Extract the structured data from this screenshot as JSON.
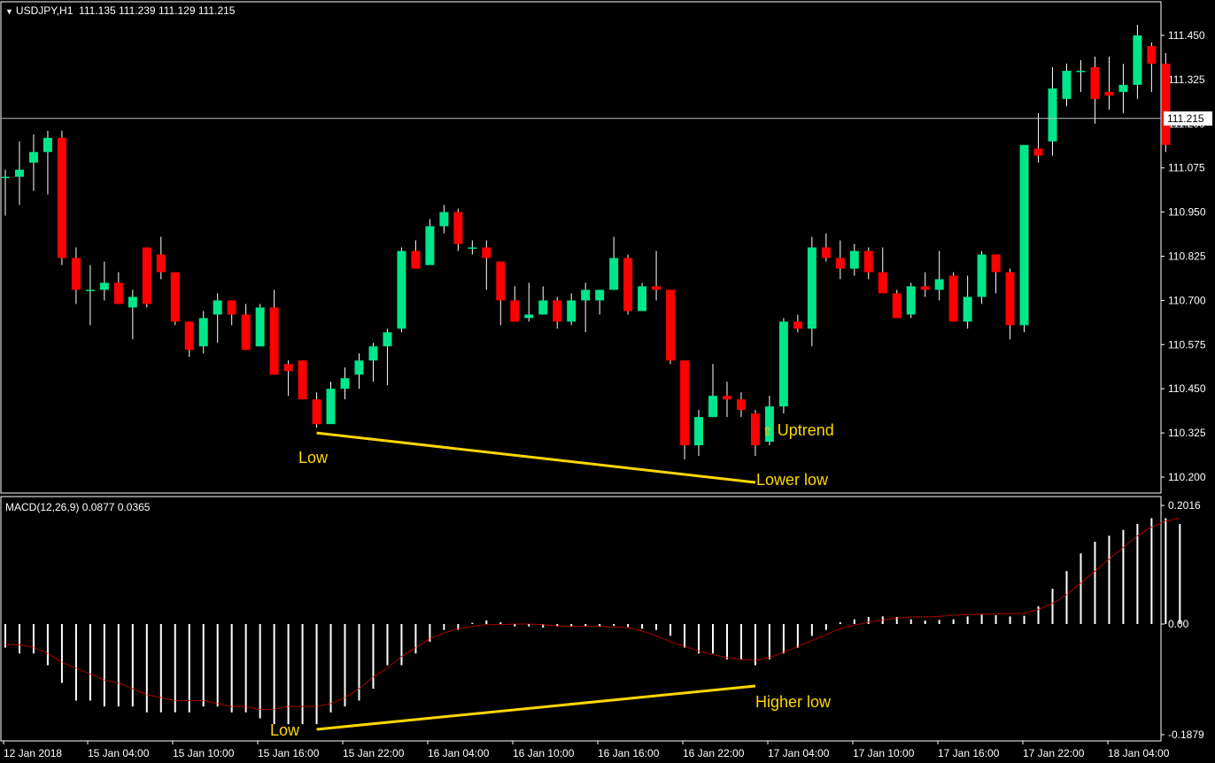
{
  "header": {
    "symbol_label": "USDJPY,H1",
    "ohlc_values": "111.135 111.239 111.129 111.215",
    "dropdown_icon": "triangle-down-icon"
  },
  "indicator": {
    "label": "MACD(12,26,9)",
    "values": "0.0877 0.0365"
  },
  "annotations": {
    "price_low": "Low",
    "price_lower_low": "Lower low",
    "uptrend": "Uptrend",
    "uptrend_icon": "arrow-up-outline-icon",
    "macd_low": "Low",
    "macd_higher_low": "Higher low"
  },
  "colors": {
    "background": "#000000",
    "bull": "#00e68a",
    "bear": "#ff0000",
    "wick": "#ffffff",
    "grid_border": "#ffffff",
    "annotation": "#ffd700",
    "signal_line": "#ff0000",
    "macd_bar": "#ffffff"
  },
  "chart_data": [
    {
      "type": "candlestick",
      "symbol": "USDJPY",
      "timeframe": "H1",
      "current_price": 111.215,
      "y_ticks": [
        "111.450",
        "111.325",
        "111.200",
        "111.075",
        "110.950",
        "110.825",
        "110.700",
        "110.575",
        "110.450",
        "110.325",
        "110.200"
      ],
      "ylim": [
        110.16,
        111.53
      ],
      "x_ticks": [
        "12 Jan 2018",
        "15 Jan 04:00",
        "15 Jan 10:00",
        "15 Jan 16:00",
        "15 Jan 22:00",
        "16 Jan 04:00",
        "16 Jan 10:00",
        "16 Jan 16:00",
        "16 Jan 22:00",
        "17 Jan 04:00",
        "17 Jan 10:00",
        "17 Jan 16:00",
        "17 Jan 22:00",
        "18 Jan 04:00"
      ],
      "candles": [
        [
          111.05,
          111.07,
          110.94,
          111.05
        ],
        [
          111.05,
          111.15,
          110.97,
          111.07
        ],
        [
          111.09,
          111.17,
          111.01,
          111.12
        ],
        [
          111.12,
          111.18,
          111.0,
          111.16
        ],
        [
          111.16,
          111.18,
          110.8,
          110.82
        ],
        [
          110.82,
          110.85,
          110.69,
          110.73
        ],
        [
          110.73,
          110.8,
          110.63,
          110.73
        ],
        [
          110.73,
          110.81,
          110.7,
          110.75
        ],
        [
          110.75,
          110.78,
          110.69,
          110.69
        ],
        [
          110.68,
          110.73,
          110.59,
          110.71
        ],
        [
          110.85,
          110.85,
          110.68,
          110.69
        ],
        [
          110.83,
          110.88,
          110.76,
          110.78
        ],
        [
          110.78,
          110.78,
          110.63,
          110.64
        ],
        [
          110.64,
          110.64,
          110.54,
          110.56
        ],
        [
          110.57,
          110.67,
          110.55,
          110.65
        ],
        [
          110.66,
          110.72,
          110.58,
          110.7
        ],
        [
          110.7,
          110.7,
          110.63,
          110.66
        ],
        [
          110.66,
          110.69,
          110.56,
          110.56
        ],
        [
          110.57,
          110.69,
          110.57,
          110.68
        ],
        [
          110.68,
          110.73,
          110.49,
          110.49
        ],
        [
          110.52,
          110.53,
          110.43,
          110.5
        ],
        [
          110.53,
          110.53,
          110.42,
          110.42
        ],
        [
          110.42,
          110.44,
          110.34,
          110.35
        ],
        [
          110.35,
          110.47,
          110.35,
          110.45
        ],
        [
          110.45,
          110.51,
          110.42,
          110.48
        ],
        [
          110.49,
          110.55,
          110.45,
          110.53
        ],
        [
          110.53,
          110.58,
          110.47,
          110.57
        ],
        [
          110.57,
          110.62,
          110.46,
          110.61
        ],
        [
          110.62,
          110.85,
          110.61,
          110.84
        ],
        [
          110.84,
          110.87,
          110.79,
          110.79
        ],
        [
          110.8,
          110.93,
          110.8,
          110.91
        ],
        [
          110.91,
          110.97,
          110.89,
          110.95
        ],
        [
          110.95,
          110.96,
          110.84,
          110.86
        ],
        [
          110.85,
          110.87,
          110.83,
          110.85
        ],
        [
          110.85,
          110.87,
          110.73,
          110.82
        ],
        [
          110.81,
          110.81,
          110.63,
          110.7
        ],
        [
          110.7,
          110.74,
          110.64,
          110.64
        ],
        [
          110.65,
          110.75,
          110.64,
          110.66
        ],
        [
          110.66,
          110.74,
          110.66,
          110.7
        ],
        [
          110.7,
          110.71,
          110.62,
          110.64
        ],
        [
          110.64,
          110.72,
          110.63,
          110.7
        ],
        [
          110.7,
          110.75,
          110.61,
          110.73
        ],
        [
          110.7,
          110.73,
          110.66,
          110.73
        ],
        [
          110.73,
          110.88,
          110.73,
          110.82
        ],
        [
          110.82,
          110.83,
          110.66,
          110.67
        ],
        [
          110.67,
          110.75,
          110.67,
          110.74
        ],
        [
          110.74,
          110.84,
          110.7,
          110.73
        ],
        [
          110.73,
          110.73,
          110.52,
          110.53
        ],
        [
          110.53,
          110.53,
          110.25,
          110.29
        ],
        [
          110.29,
          110.39,
          110.26,
          110.37
        ],
        [
          110.37,
          110.52,
          110.37,
          110.43
        ],
        [
          110.43,
          110.47,
          110.37,
          110.42
        ],
        [
          110.42,
          110.44,
          110.37,
          110.39
        ],
        [
          110.38,
          110.39,
          110.26,
          110.29
        ],
        [
          110.3,
          110.43,
          110.29,
          110.4
        ],
        [
          110.4,
          110.65,
          110.38,
          110.64
        ],
        [
          110.64,
          110.66,
          110.61,
          110.62
        ],
        [
          110.62,
          110.88,
          110.57,
          110.85
        ],
        [
          110.85,
          110.89,
          110.81,
          110.82
        ],
        [
          110.82,
          110.87,
          110.76,
          110.79
        ],
        [
          110.79,
          110.86,
          110.77,
          110.84
        ],
        [
          110.84,
          110.85,
          110.76,
          110.78
        ],
        [
          110.78,
          110.85,
          110.73,
          110.72
        ],
        [
          110.72,
          110.73,
          110.65,
          110.65
        ],
        [
          110.66,
          110.75,
          110.65,
          110.74
        ],
        [
          110.74,
          110.78,
          110.71,
          110.73
        ],
        [
          110.73,
          110.84,
          110.7,
          110.76
        ],
        [
          110.77,
          110.78,
          110.64,
          110.64
        ],
        [
          110.64,
          110.77,
          110.62,
          110.71
        ],
        [
          110.71,
          110.84,
          110.69,
          110.83
        ],
        [
          110.83,
          110.83,
          110.72,
          110.78
        ],
        [
          110.78,
          110.79,
          110.59,
          110.63
        ],
        [
          110.63,
          110.81,
          110.61,
          111.14
        ],
        [
          111.13,
          111.23,
          111.09,
          111.11
        ],
        [
          111.15,
          111.36,
          111.11,
          111.3
        ],
        [
          111.27,
          111.37,
          111.25,
          111.35
        ],
        [
          111.35,
          111.38,
          111.29,
          111.35
        ],
        [
          111.36,
          111.39,
          111.2,
          111.27
        ],
        [
          111.29,
          111.39,
          111.24,
          111.28
        ],
        [
          111.29,
          111.37,
          111.23,
          111.31
        ],
        [
          111.31,
          111.48,
          111.27,
          111.45
        ],
        [
          111.42,
          111.43,
          111.29,
          111.37
        ],
        [
          111.37,
          111.4,
          111.12,
          111.14
        ]
      ]
    },
    {
      "type": "bar",
      "title": "MACD(12,26,9)",
      "macd": 0.0877,
      "signal": 0.0365,
      "y_ticks": [
        "0.2016",
        "0.00",
        "-0.1879"
      ],
      "ylim": [
        -0.1879,
        0.2016
      ],
      "histogram": [
        -0.04,
        -0.05,
        -0.05,
        -0.07,
        -0.1,
        -0.13,
        -0.13,
        -0.14,
        -0.14,
        -0.14,
        -0.15,
        -0.15,
        -0.15,
        -0.15,
        -0.14,
        -0.14,
        -0.15,
        -0.15,
        -0.16,
        -0.17,
        -0.17,
        -0.17,
        -0.17,
        -0.15,
        -0.14,
        -0.13,
        -0.11,
        -0.07,
        -0.07,
        -0.05,
        -0.03,
        -0.01,
        -0.01,
        0.002,
        0.006,
        0.003,
        -0.004,
        -0.004,
        -0.006,
        -0.004,
        -0.004,
        -0.004,
        -0.004,
        -0.003,
        -0.005,
        -0.008,
        -0.01,
        -0.02,
        -0.04,
        -0.05,
        -0.05,
        -0.06,
        -0.06,
        -0.07,
        -0.06,
        -0.05,
        -0.04,
        -0.02,
        -0.01,
        0.003,
        0.008,
        0.012,
        0.013,
        0.012,
        0.008,
        0.006,
        0.007,
        0.008,
        0.013,
        0.016,
        0.015,
        0.013,
        0.014,
        0.03,
        0.06,
        0.09,
        0.12,
        0.14,
        0.15,
        0.16,
        0.17,
        0.18,
        0.18,
        0.17
      ],
      "signal_line": [
        -0.035,
        -0.035,
        -0.04,
        -0.05,
        -0.065,
        -0.075,
        -0.085,
        -0.095,
        -0.1,
        -0.11,
        -0.12,
        -0.125,
        -0.13,
        -0.13,
        -0.13,
        -0.135,
        -0.14,
        -0.14,
        -0.145,
        -0.145,
        -0.14,
        -0.14,
        -0.14,
        -0.135,
        -0.125,
        -0.11,
        -0.09,
        -0.075,
        -0.055,
        -0.04,
        -0.025,
        -0.015,
        -0.008,
        -0.004,
        -0.001,
        -0.001,
        0.0,
        0.0,
        -0.001,
        -0.003,
        -0.004,
        -0.004,
        -0.004,
        -0.005,
        -0.006,
        -0.012,
        -0.02,
        -0.03,
        -0.038,
        -0.046,
        -0.052,
        -0.057,
        -0.06,
        -0.062,
        -0.057,
        -0.048,
        -0.038,
        -0.028,
        -0.018,
        -0.008,
        -0.002,
        0.003,
        0.007,
        0.01,
        0.012,
        0.012,
        0.013,
        0.015,
        0.016,
        0.017,
        0.017,
        0.018,
        0.018,
        0.025,
        0.035,
        0.05,
        0.07,
        0.09,
        0.11,
        0.13,
        0.15,
        0.165,
        0.175,
        0.18
      ]
    }
  ]
}
